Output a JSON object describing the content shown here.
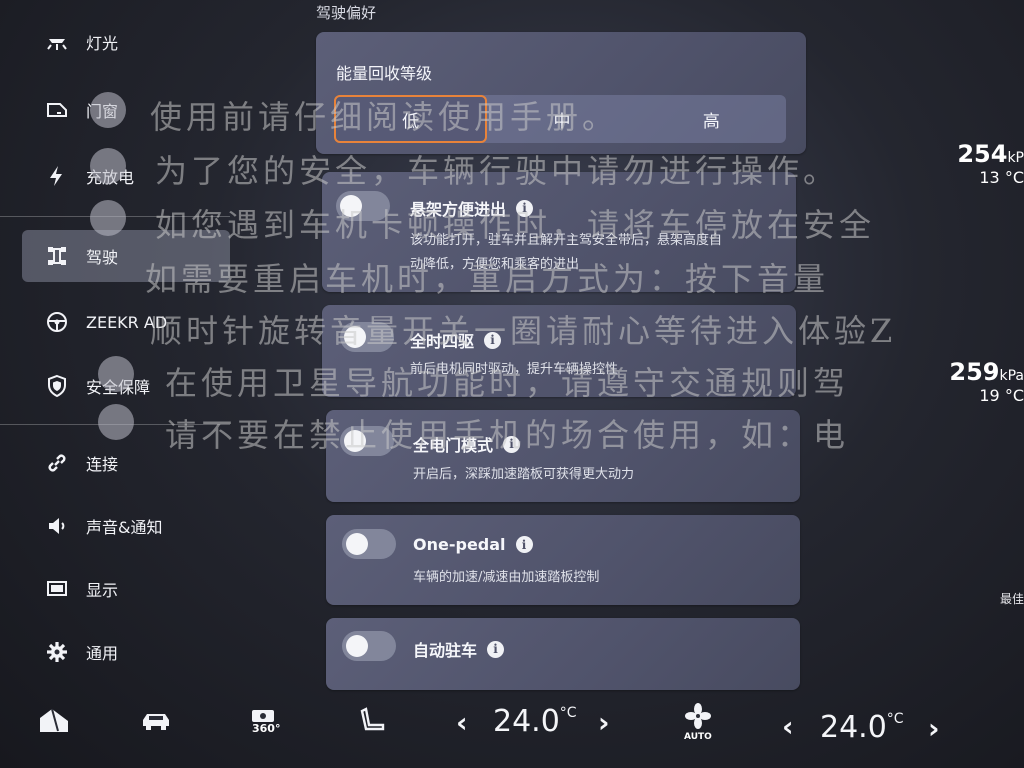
{
  "section_title": "驾驶偏好",
  "sidebar": {
    "items": [
      {
        "label": "灯光",
        "icon": "light-icon"
      },
      {
        "label": "门窗",
        "icon": "door-icon"
      },
      {
        "label": "充放电",
        "icon": "charge-icon"
      },
      {
        "label": "驾驶",
        "icon": "drive-icon",
        "active": true
      },
      {
        "label": "ZEEKR AD",
        "icon": "steering-wheel-icon"
      },
      {
        "label": "安全保障",
        "icon": "shield-icon"
      },
      {
        "label": "连接",
        "icon": "link-icon"
      },
      {
        "label": "声音&通知",
        "icon": "speaker-icon"
      },
      {
        "label": "显示",
        "icon": "display-icon"
      },
      {
        "label": "通用",
        "icon": "gear-icon"
      }
    ]
  },
  "energy_recovery": {
    "title": "能量回收等级",
    "options": [
      "低",
      "中",
      "高"
    ],
    "selected": "低"
  },
  "settings": [
    {
      "title": "悬架方便进出",
      "desc_line1": "该功能打开，驻车并且解开主驾安全带后，悬架高度自",
      "desc_line2": "动降低，方便您和乘客的进出",
      "enabled": false
    },
    {
      "title": "全时四驱",
      "desc_line1": "前后电机同时驱动，提升车辆操控性",
      "desc_line2": "",
      "enabled": false
    },
    {
      "title": "全电门模式",
      "desc_line1": "开启后，深踩加速踏板可获得更大动力",
      "desc_line2": "",
      "enabled": false
    },
    {
      "title": "One-pedal",
      "desc_line1": "车辆的加速/减速由加速踏板控制",
      "desc_line2": "",
      "enabled": false
    },
    {
      "title": "自动驻车",
      "desc_line1": "",
      "desc_line2": "",
      "enabled": false
    }
  ],
  "tires": [
    {
      "pressure": "254",
      "unit": "kP",
      "temp": "13 °C"
    },
    {
      "pressure": "259",
      "unit": "kPa",
      "temp": "19 °C"
    }
  ],
  "right_edge_text": "最佳",
  "climate": {
    "left_temp": "24.0",
    "right_temp": "24.0",
    "unit": "°C",
    "fan_mode": "AUTO"
  },
  "bottom_icons": [
    "home-icon",
    "car-icon",
    "camera-360-icon",
    "seat-icon",
    "fan-icon"
  ],
  "bottom_360_label": "360°",
  "notice_overlay": [
    "使用前请仔细阅读使用手册。",
    "为了您的安全，车辆行驶中请勿进行操作。",
    "如您遇到车机卡顿操作时，请将车停放在安全",
    "如需要重启车机时，重启方式为：按下音量",
    "顺时针旋转音量开关一圈请耐心等待进入体验Z",
    "在使用卫星导航功能时，请遵守交通规则驾",
    "请不要在禁止使用手机的场合使用，如：电"
  ],
  "colors": {
    "accent_selected_border": "#e8833a",
    "active_sidebar_bg": "#8f94ab"
  }
}
